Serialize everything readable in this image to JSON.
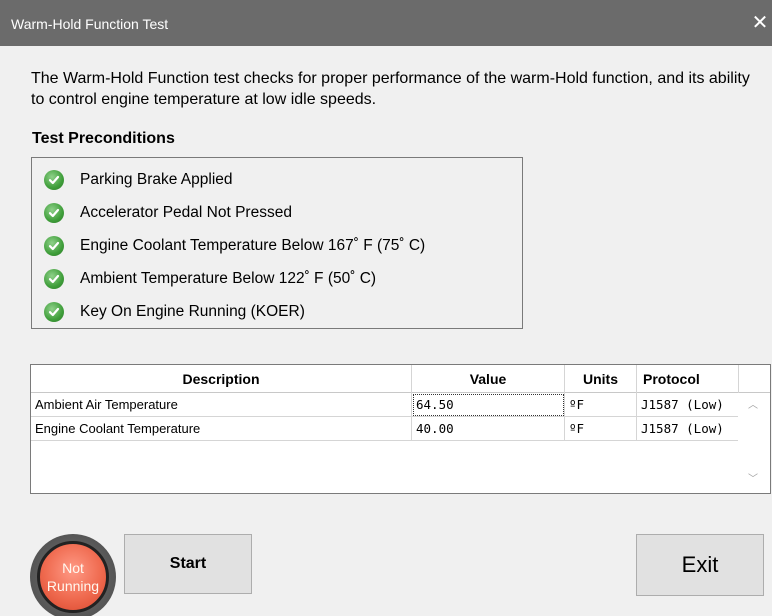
{
  "window": {
    "title": "Warm-Hold Function Test",
    "close_glyph": "✕"
  },
  "intro": {
    "text": "The Warm-Hold Function test checks for proper performance of the warm-Hold function, and its ability to control engine temperature at low idle speeds."
  },
  "preconditions": {
    "heading": "Test Preconditions",
    "items": [
      {
        "label": "Parking Brake Applied",
        "icon": "check-circle-icon"
      },
      {
        "label": "Accelerator Pedal Not Pressed",
        "icon": "check-circle-icon"
      },
      {
        "label": "Engine Coolant Temperature  Below 167˚ F (75˚ C)",
        "icon": "check-circle-icon"
      },
      {
        "label": "Ambient Temperature Below 122˚ F (50˚ C)",
        "icon": "check-circle-icon"
      },
      {
        "label": "Key On Engine Running (KOER)",
        "icon": "check-circle-icon"
      }
    ],
    "check_color": "#3f9e3a"
  },
  "table": {
    "columns": [
      "Description",
      "Value",
      "Units",
      "Protocol"
    ],
    "rows": [
      [
        "Ambient Air Temperature",
        "64.50",
        "ºF",
        "J1587 (Low)"
      ],
      [
        "Engine Coolant Temperature",
        "40.00",
        "ºF",
        "J1587 (Low)"
      ]
    ]
  },
  "status": {
    "text": "Not Running",
    "color": "#ef6a4f"
  },
  "buttons": {
    "start": "Start",
    "exit": "Exit"
  }
}
